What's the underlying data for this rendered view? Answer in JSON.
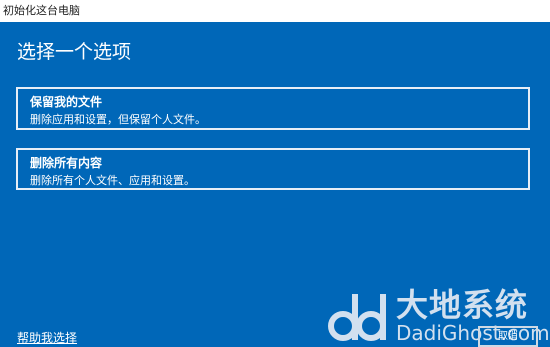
{
  "window": {
    "title": "初始化这台电脑",
    "background_color": "#0067b8"
  },
  "main": {
    "heading": "选择一个选项",
    "options": [
      {
        "title": "保留我的文件",
        "description": "删除应用和设置，但保留个人文件。"
      },
      {
        "title": "删除所有内容",
        "description": "删除所有个人文件、应用和设置。"
      }
    ]
  },
  "footer": {
    "help_link": "帮助我选择",
    "cancel_label": "取消"
  },
  "watermark": {
    "brand_cn": "大地系统",
    "brand_en": "DadiGhost.com",
    "icon": "dd-logo-icon"
  }
}
